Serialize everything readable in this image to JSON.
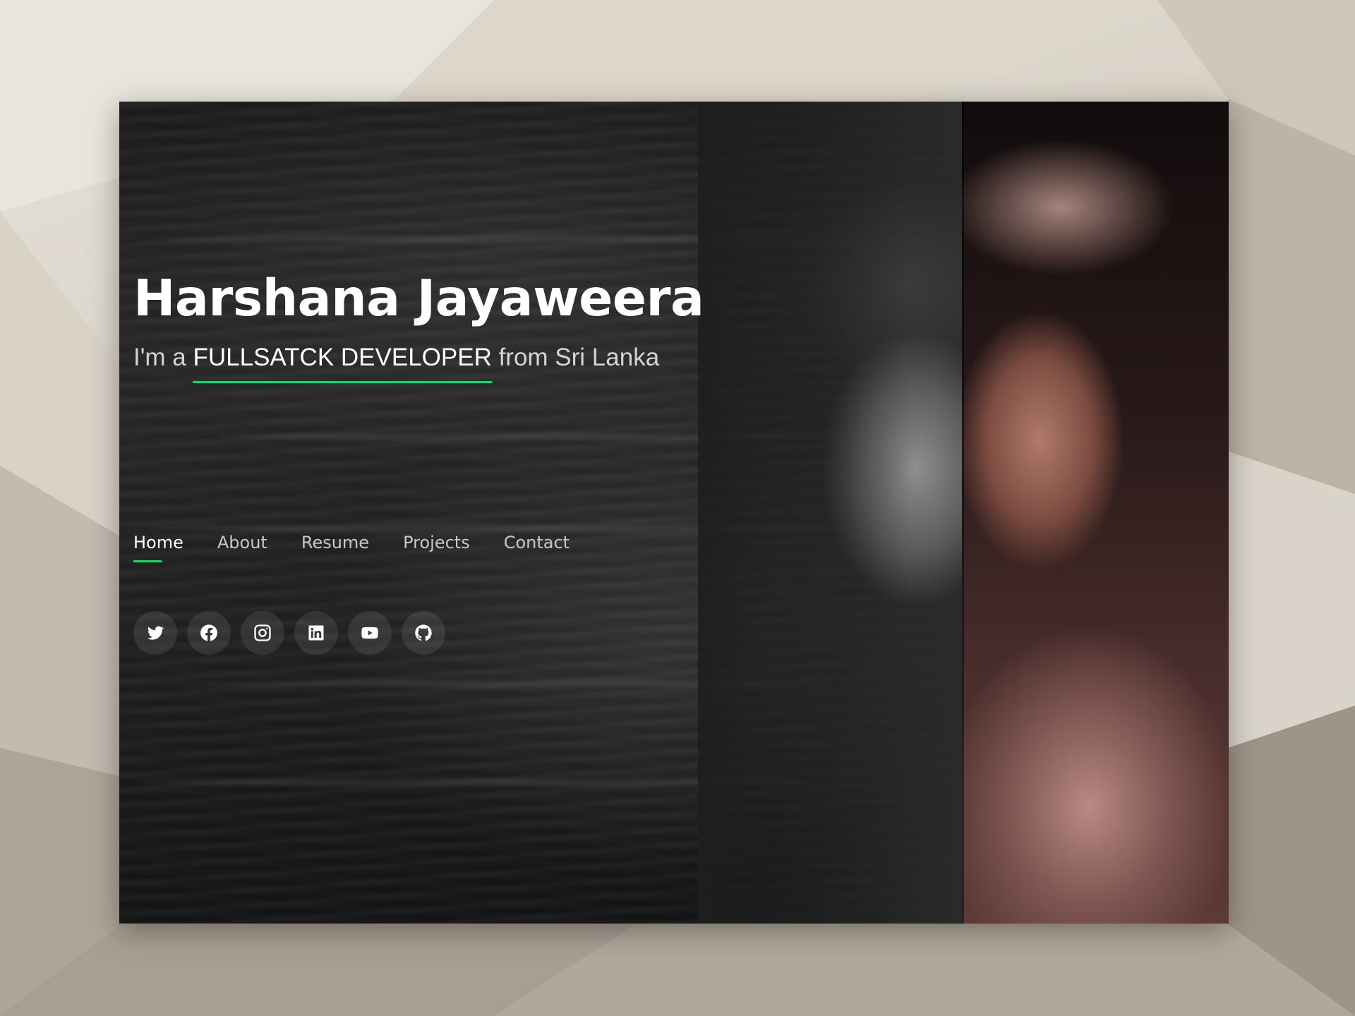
{
  "hero": {
    "name": "Harshana Jayaweera",
    "subtitle_prefix": "I'm a ",
    "role": "FULLSATCK DEVELOPER",
    "subtitle_suffix": " from Sri Lanka"
  },
  "nav": {
    "items": [
      {
        "label": "Home",
        "active": true
      },
      {
        "label": "About",
        "active": false
      },
      {
        "label": "Resume",
        "active": false
      },
      {
        "label": "Projects",
        "active": false
      },
      {
        "label": "Contact",
        "active": false
      }
    ]
  },
  "social": [
    "twitter-icon",
    "facebook-icon",
    "instagram-icon",
    "linkedin-icon",
    "youtube-icon",
    "github-icon"
  ],
  "colors": {
    "accent": "#18d26e",
    "text": "#ffffff",
    "muted_text": "#c8c8c8",
    "background": "#1e1e1e"
  }
}
